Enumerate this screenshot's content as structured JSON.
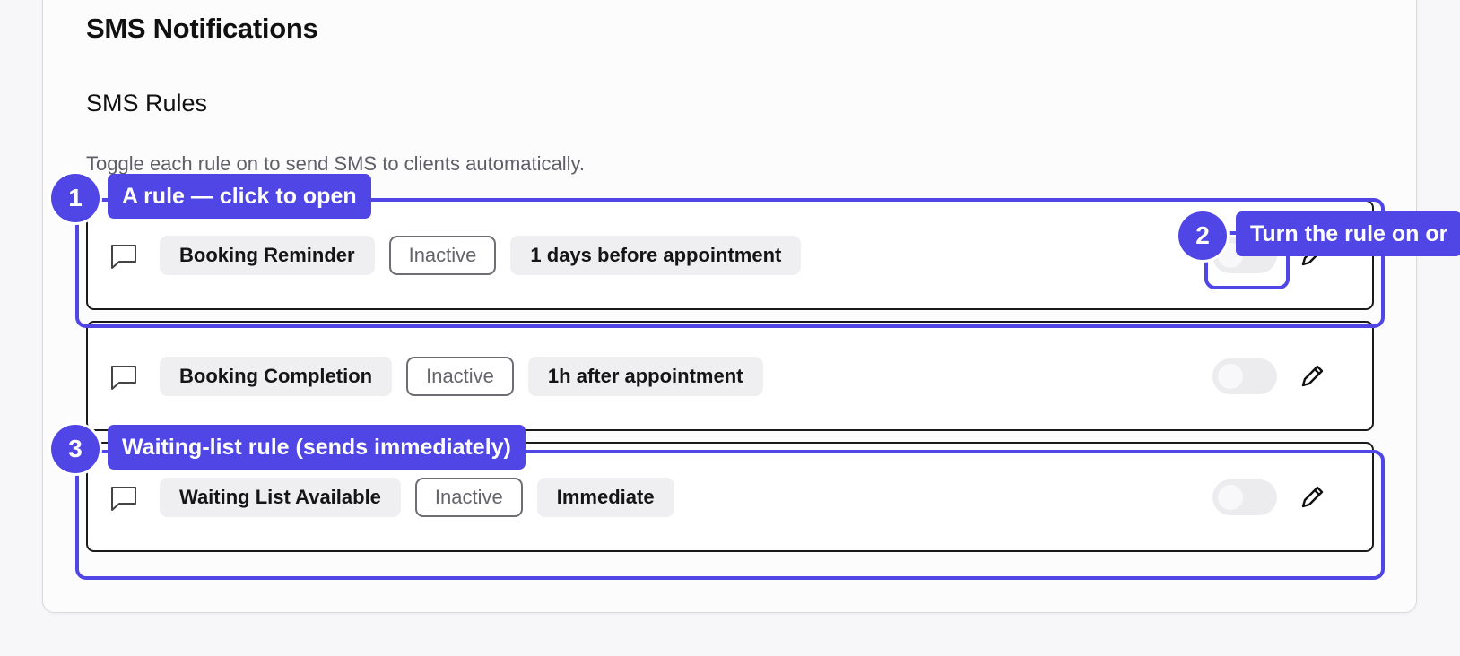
{
  "page": {
    "title": "SMS Notifications"
  },
  "section": {
    "title": "SMS Rules",
    "description": "Toggle each rule on to send SMS to clients automatically."
  },
  "rules": [
    {
      "icon": "message-icon",
      "name": "Booking Reminder",
      "status": "Inactive",
      "timing": "1 days before appointment",
      "enabled": false
    },
    {
      "icon": "message-icon",
      "name": "Booking Completion",
      "status": "Inactive",
      "timing": "1h after appointment",
      "enabled": false
    },
    {
      "icon": "message-icon",
      "name": "Waiting List Available",
      "status": "Inactive",
      "timing": "Immediate",
      "enabled": false
    }
  ],
  "callouts": [
    {
      "number": "1",
      "text": "A rule — click to open"
    },
    {
      "number": "2",
      "text": "Turn the rule on or"
    },
    {
      "number": "3",
      "text": "Waiting-list rule (sends immediately)"
    }
  ],
  "colors": {
    "accent": "#4f46e5",
    "border": "#1a1a1a",
    "pill_bg": "#efeff2",
    "muted_text": "#5e5e66"
  }
}
